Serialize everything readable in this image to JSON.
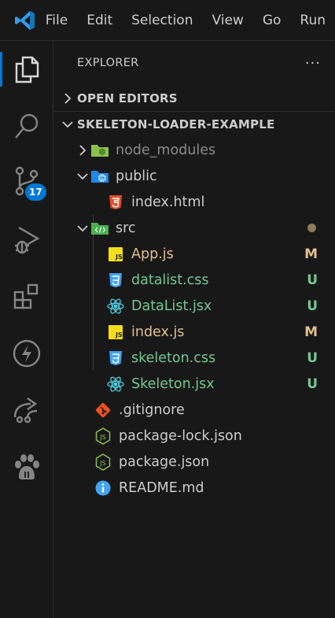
{
  "menu": [
    "File",
    "Edit",
    "Selection",
    "View",
    "Go",
    "Run"
  ],
  "activity": {
    "explorer": "files-icon",
    "search": "search-icon",
    "scm": "source-control-icon",
    "scm_badge": "17",
    "debug": "run-debug-icon",
    "extensions": "extensions-icon",
    "thunder": "lightning-icon",
    "remote": "share-icon",
    "paw": "paw-icon"
  },
  "explorer": {
    "title": "EXPLORER",
    "more": "···",
    "open_editors": "OPEN EDITORS",
    "project": "SKELETON-LOADER-EXAMPLE",
    "items": [
      {
        "label": "node_modules",
        "status": ""
      },
      {
        "label": "public",
        "status": ""
      },
      {
        "label": "index.html",
        "status": ""
      },
      {
        "label": "src",
        "status": ""
      },
      {
        "label": "App.js",
        "status": "M"
      },
      {
        "label": "datalist.css",
        "status": "U"
      },
      {
        "label": "DataList.jsx",
        "status": "U"
      },
      {
        "label": "index.js",
        "status": "M"
      },
      {
        "label": "skeleton.css",
        "status": "U"
      },
      {
        "label": "Skeleton.jsx",
        "status": "U"
      },
      {
        "label": ".gitignore",
        "status": ""
      },
      {
        "label": "package-lock.json",
        "status": ""
      },
      {
        "label": "package.json",
        "status": ""
      },
      {
        "label": "README.md",
        "status": ""
      }
    ]
  },
  "colors": {
    "accent": "#0078d4",
    "modified": "#e2c08d",
    "untracked": "#73c991"
  }
}
